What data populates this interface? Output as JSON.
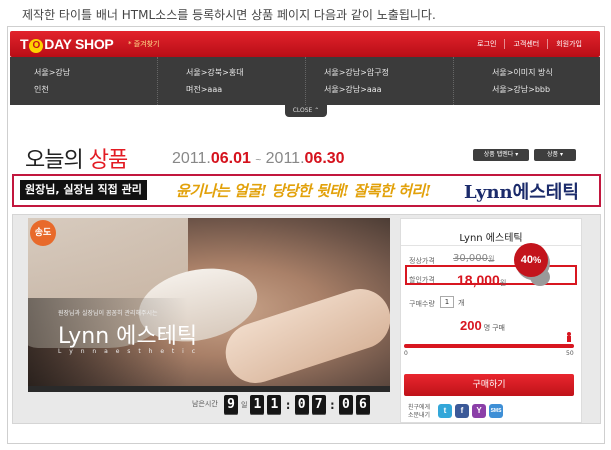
{
  "caption": "제작한 타이틀 배너 HTML소스를 등록하시면 상품 페이지 다음과 같이 노출됩니다.",
  "header": {
    "logo_pre": "T",
    "logo_o": "O",
    "logo_post": "DAY SHOP",
    "logo_sub": "* 즐겨찾기",
    "links": [
      "로그인",
      "고객센터",
      "회원가입"
    ]
  },
  "region_menu": {
    "links": [
      "서울>강남",
      "인천",
      "서울>강북>홍대",
      "며전>aaa",
      "서울>강남>압구정",
      "서울>강남>aaa",
      "서울>이미지 방식",
      "서울>강남>bbb"
    ],
    "close_label": "CLOSE ⌃"
  },
  "headline": {
    "text_black": "오늘의",
    "text_red": "상품",
    "date_start_year": "2011.",
    "date_start_md": "06.01",
    "date_sep": "~",
    "date_end_year": "2011.",
    "date_end_md": "06.30",
    "button1": "상품 탭멘다 ▾",
    "button2": "상품 ▾"
  },
  "banner": {
    "block_text": "원장님, 실장님 직접 관리",
    "slogan": "윤기나는 얼굴! 당당한 뒷태! 잘록한 허리!",
    "brand": "Lynn에스테틱"
  },
  "photo": {
    "badge": "송도",
    "overlay_sub": "원장님과 실장님이 꼼꼼히 관리해주시는",
    "overlay_name": "Lynn 에스테틱",
    "overlay_en": "L y n n  a e s t h e t i c"
  },
  "countdown": {
    "label": "남은시간",
    "days": "9",
    "day_unit": "일",
    "h1": "1",
    "h2": "1",
    "m1": "0",
    "m2": "7",
    "s1": "0",
    "s2": "6"
  },
  "detail": {
    "title": "Lynn 에스테틱",
    "orig_label": "정상가격",
    "orig_price": "30,000",
    "orig_unit": "원",
    "disc_label": "할인가격",
    "disc_price": "18,000",
    "disc_unit": "원",
    "discount_pct": "40",
    "discount_pct_suffix": "%",
    "qty_label": "구매수량",
    "qty_value": "1",
    "qty_unit": "개",
    "buyers": "200",
    "buyers_unit": "명 구매",
    "progress_fraction": 1.0,
    "track_min": "0",
    "track_max": "50",
    "buy_label": "구매하기",
    "share_label": "친구에게 소문내기",
    "share_icons": [
      "twitter-icon",
      "facebook-icon",
      "yozm-icon",
      "sms-icon"
    ],
    "share_glyphs": [
      "t",
      "f",
      "Y",
      "SMS"
    ],
    "share_colors": [
      "#33a7d9",
      "#3b5998",
      "#8b3fa8",
      "#3e8fd6"
    ]
  },
  "colors": {
    "brand_red": "#d81620",
    "menu_dark": "#3b3b3b",
    "banner_border": "#c2173e"
  }
}
